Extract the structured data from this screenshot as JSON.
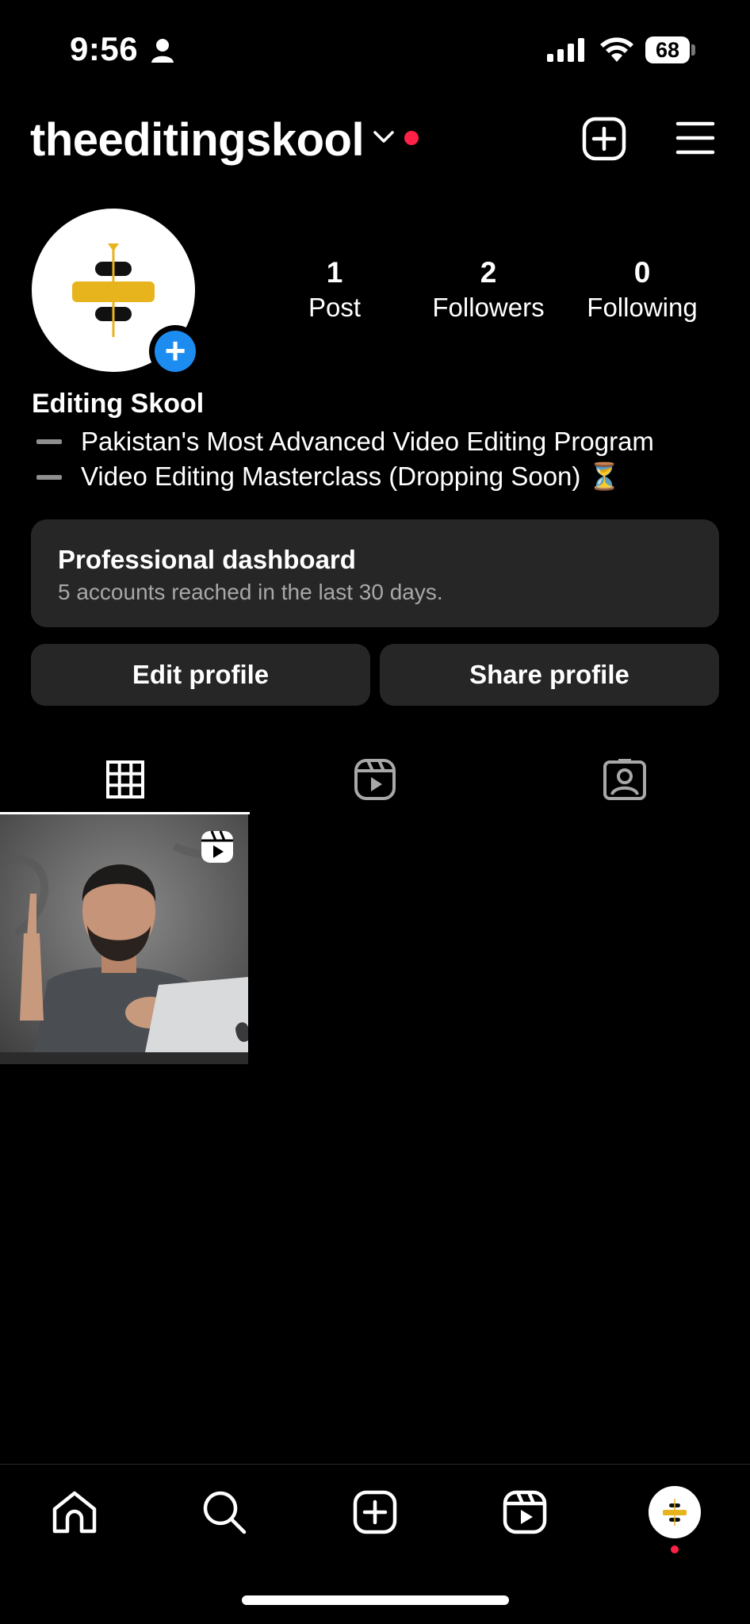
{
  "status_bar": {
    "time": "9:56",
    "battery": "68",
    "icons": [
      "person-icon",
      "signal-icon",
      "wifi-icon",
      "battery-icon"
    ]
  },
  "header": {
    "username": "theeditingskool",
    "icons": [
      "chevron-down-icon",
      "notification-dot",
      "new-post-icon",
      "menu-icon"
    ]
  },
  "profile": {
    "stats": [
      {
        "value": "1",
        "label": "Post"
      },
      {
        "value": "2",
        "label": "Followers"
      },
      {
        "value": "0",
        "label": "Following"
      }
    ],
    "display_name": "Editing Skool",
    "bio_lines": [
      "Pakistan's Most Advanced Video Editing Program",
      "Video Editing Masterclass (Dropping Soon) ⏳"
    ]
  },
  "dashboard": {
    "title": "Professional dashboard",
    "subtitle": "5 accounts reached in the last 30 days."
  },
  "actions": {
    "edit": "Edit profile",
    "share": "Share profile"
  },
  "tabs": [
    "grid-icon",
    "reels-icon",
    "tagged-icon"
  ],
  "bottom_nav": [
    "home-icon",
    "search-icon",
    "create-icon",
    "reels-icon",
    "profile-avatar"
  ],
  "colors": {
    "background": "#000000",
    "card": "#262626",
    "accent_blue": "#1d8cf0",
    "notification_red": "#ff2146",
    "logo_yellow": "#e8b41e"
  }
}
